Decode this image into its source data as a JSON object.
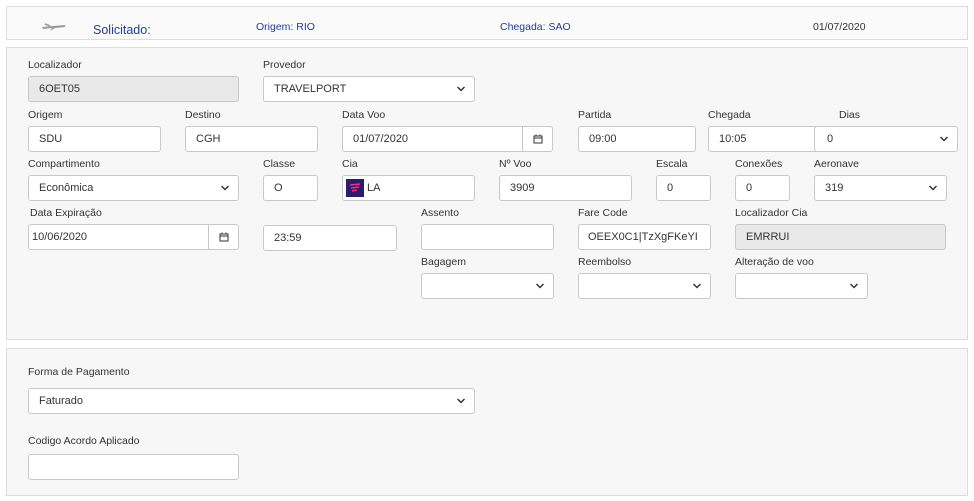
{
  "header": {
    "status": "Solicitado:",
    "origin_label": "Origem:",
    "origin_value": "RIO",
    "arrival_label": "Chegada:",
    "arrival_value": "SAO",
    "date": "01/07/2020"
  },
  "flight": {
    "localizador": {
      "label": "Localizador",
      "value": "6OET05"
    },
    "provedor": {
      "label": "Provedor",
      "value": "TRAVELPORT"
    },
    "origem": {
      "label": "Origem",
      "value": "SDU"
    },
    "destino": {
      "label": "Destino",
      "value": "CGH"
    },
    "data_voo": {
      "label": "Data Voo",
      "value": "01/07/2020"
    },
    "partida": {
      "label": "Partida",
      "value": "09:00"
    },
    "chegada": {
      "label": "Chegada",
      "value": "10:05"
    },
    "dias": {
      "label": "Dias",
      "value": "0"
    },
    "compartimento": {
      "label": "Compartimento",
      "value": "Econômica"
    },
    "classe": {
      "label": "Classe",
      "value": "O"
    },
    "cia": {
      "label": "Cia",
      "value": "LA"
    },
    "n_voo": {
      "label": "Nº Voo",
      "value": "3909"
    },
    "escala": {
      "label": "Escala",
      "value": "0"
    },
    "conexoes": {
      "label": "Conexões",
      "value": "0"
    },
    "aeronave": {
      "label": "Aeronave",
      "value": "319"
    },
    "data_expiracao": {
      "label": "Data Expiração",
      "value": "10/06/2020"
    },
    "hora_expiracao": {
      "value": "23:59"
    },
    "assento": {
      "label": "Assento",
      "value": ""
    },
    "fare_code": {
      "label": "Fare Code",
      "value": "OEEX0C1|TzXgFKeYI"
    },
    "localizador_cia": {
      "label": "Localizador Cia",
      "value": "EMRRUI"
    },
    "bagagem": {
      "label": "Bagagem",
      "value": ""
    },
    "reembolso": {
      "label": "Reembolso",
      "value": ""
    },
    "alteracao_voo": {
      "label": "Alteração de voo",
      "value": ""
    }
  },
  "payment": {
    "forma_pagamento": {
      "label": "Forma de Pagamento",
      "value": "Faturado"
    },
    "codigo_acordo": {
      "label": "Codigo Acordo Aplicado",
      "value": ""
    }
  },
  "icons": {
    "plane": "plane-icon",
    "chevron": "chevron-down-icon",
    "calendar": "calendar-icon",
    "airline": "latam-logo-icon"
  },
  "colors": {
    "header_text": "#1f3d99",
    "panel_bg": "#f7f7f7",
    "readonly_bg": "#e9e9e9",
    "airline_logo": "#2d1b6e"
  }
}
